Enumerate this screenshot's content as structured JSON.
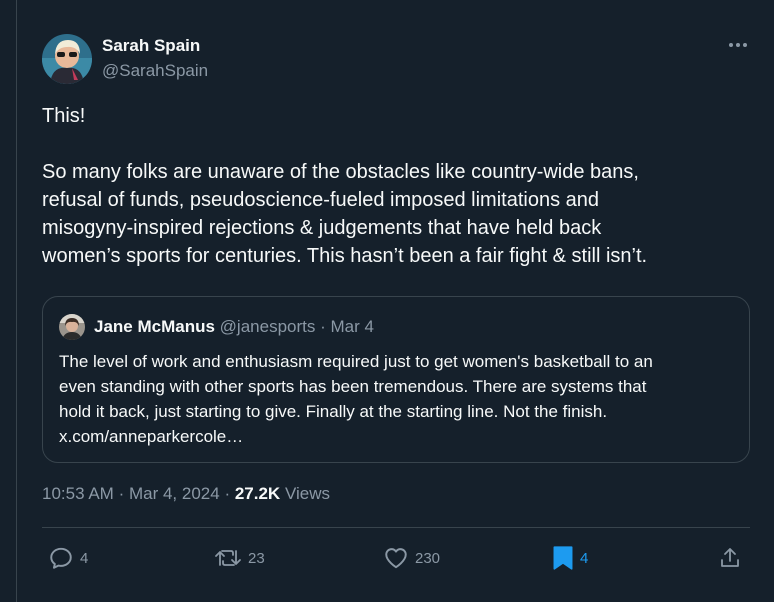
{
  "tweet": {
    "author": {
      "name": "Sarah Spain",
      "handle": "@SarahSpain"
    },
    "text_lines": [
      "This!",
      "",
      "So many folks are unaware of the obstacles like country-wide bans,",
      "refusal of funds, pseudoscience-fueled imposed limitations and",
      "misogyny-inspired rejections & judgements that have held back",
      "women’s sports for centuries. This hasn’t been a fair fight & still isn’t."
    ],
    "quote": {
      "name": "Jane McManus",
      "handle": "@janesports",
      "separator": "·",
      "date": "Mar 4",
      "text_lines": [
        "The level of work and enthusiasm required just to get women's basketball to an",
        "even standing with other sports has been tremendous. There are systems that",
        "hold it back, just starting to give. Finally at the starting line. Not the finish.",
        "x.com/anneparkercole…"
      ]
    },
    "meta": {
      "time": "10:53 AM",
      "separator": "·",
      "date": "Mar 4, 2024",
      "separator2": "·",
      "views_count": "27.2K",
      "views_label": "Views"
    },
    "actions": {
      "replies": "4",
      "reposts": "23",
      "likes": "230",
      "bookmarks": "4"
    }
  },
  "icons": {
    "more": "more-horizontal-icon",
    "reply": "reply-icon",
    "repost": "repost-icon",
    "like": "heart-icon",
    "bookmark": "bookmark-icon",
    "share": "share-icon"
  },
  "colors": {
    "background": "#15202b",
    "text_primary": "#f7f9f9",
    "text_secondary": "#8b98a5",
    "border": "#38444d",
    "accent": "#1d9bf0"
  }
}
